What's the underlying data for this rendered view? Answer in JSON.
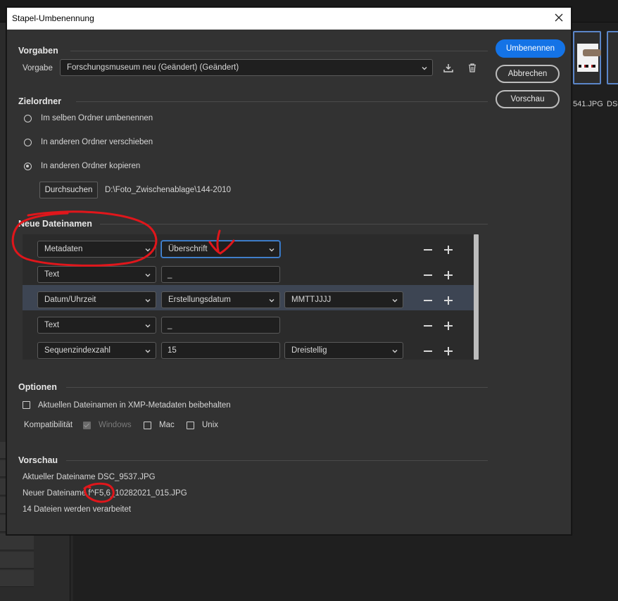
{
  "dialog": {
    "title": "Stapel-Umbenennung"
  },
  "actions": {
    "rename": "Umbenennen",
    "cancel": "Abbrechen",
    "preview": "Vorschau"
  },
  "presets": {
    "section": "Vorgaben",
    "label": "Vorgabe",
    "value": "Forschungsmuseum neu (Geändert) (Geändert)"
  },
  "target": {
    "section": "Zielordner",
    "options": [
      "Im selben Ordner umbenennen",
      "In anderen Ordner verschieben",
      "In anderen Ordner kopieren"
    ],
    "selected": 2,
    "browse": "Durchsuchen",
    "path": "D:\\Foto_Zwischenablage\\144-2010"
  },
  "naming": {
    "section": "Neue Dateinamen",
    "rows": [
      {
        "type": "Metadaten",
        "field": "Überschrift"
      },
      {
        "type": "Text",
        "field": "_"
      },
      {
        "type": "Datum/Uhrzeit",
        "field": "Erstellungsdatum",
        "format": "MMTTJJJJ"
      },
      {
        "type": "Text",
        "field": "_"
      },
      {
        "type": "Sequenzindexzahl",
        "field": "15",
        "format": "Dreistellig"
      }
    ]
  },
  "options": {
    "section": "Optionen",
    "keep_xmp": "Aktuellen Dateinamen in XMP-Metadaten beibehalten",
    "compat_label": "Kompatibilität",
    "windows": "Windows",
    "mac": "Mac",
    "unix": "Unix"
  },
  "preview": {
    "section": "Vorschau",
    "current": "Aktueller Dateiname DSC_9537.JPG",
    "new": "Neuer Dateiname f^F5,6_10282021_015.JPG",
    "count": "14 Dateien werden verarbeitet"
  },
  "background": {
    "thumb1_name": "541.JPG",
    "thumb2_name": "DSC"
  },
  "colors": {
    "primary": "#1473e6",
    "annotation": "#e0161b",
    "dialog_bg": "#323232"
  }
}
